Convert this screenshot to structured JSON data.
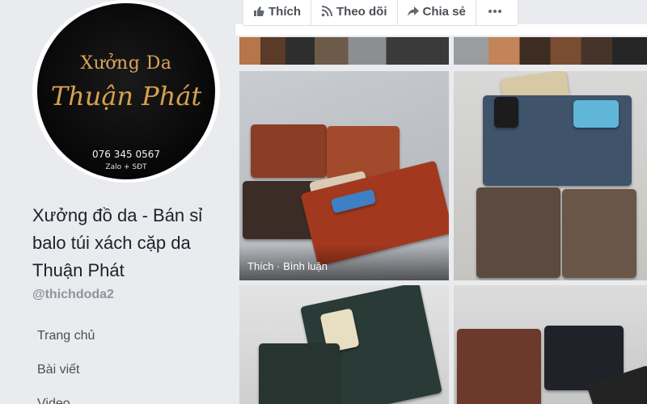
{
  "sidebar": {
    "logo": {
      "line1": "Xưởng Da",
      "line2": "Thuận Phát",
      "phone": "076 345 0567",
      "contact": "Zalo + SĐT"
    },
    "page_name": "Xưởng đồ da - Bán sỉ balo túi xách cặp da Thuận Phát",
    "handle": "@thichdoda2",
    "nav": [
      {
        "label": "Trang chủ"
      },
      {
        "label": "Bài viết"
      },
      {
        "label": "Video"
      }
    ]
  },
  "actions": {
    "like": "Thích",
    "follow": "Theo dõi",
    "share": "Chia sẻ",
    "more_icon": "more-dots-icon"
  },
  "photos": {
    "hover_caption": "Thích · Bình luận"
  },
  "colors": {
    "page_bg": "#e9ebee",
    "logo_gold": "#d8a050",
    "text_muted": "#90949c"
  }
}
